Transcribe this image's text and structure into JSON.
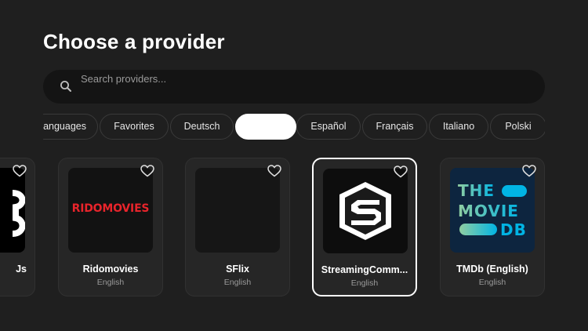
{
  "header": {
    "title": "Choose a provider"
  },
  "search": {
    "placeholder": "Search providers..."
  },
  "filters": [
    {
      "label": "Languages",
      "display": "anguages",
      "selected": false
    },
    {
      "label": "Favorites",
      "selected": false
    },
    {
      "label": "Deutsch",
      "selected": false
    },
    {
      "label": "",
      "selected": true
    },
    {
      "label": "Español",
      "selected": false
    },
    {
      "label": "Français",
      "selected": false
    },
    {
      "label": "Italiano",
      "selected": false
    },
    {
      "label": "Polski",
      "selected": false
    }
  ],
  "providers": [
    {
      "name": "Js",
      "language": ""
    },
    {
      "name": "Ridomovies",
      "language": "English",
      "logo_text": "RIDOMOVIES"
    },
    {
      "name": "SFlix",
      "language": "English"
    },
    {
      "name": "StreamingComm...",
      "language": "English",
      "focused": true
    },
    {
      "name": "TMDb (English)",
      "language": "English",
      "logo_text": [
        "THE",
        "MOVIE",
        "DB"
      ]
    }
  ],
  "colors": {
    "background": "#1f1f1f",
    "card": "#262626",
    "search_bg": "#141414",
    "rido_red": "#e8242b",
    "tmdb_teal": "#90cea1",
    "tmdb_blue": "#01b4e4"
  }
}
